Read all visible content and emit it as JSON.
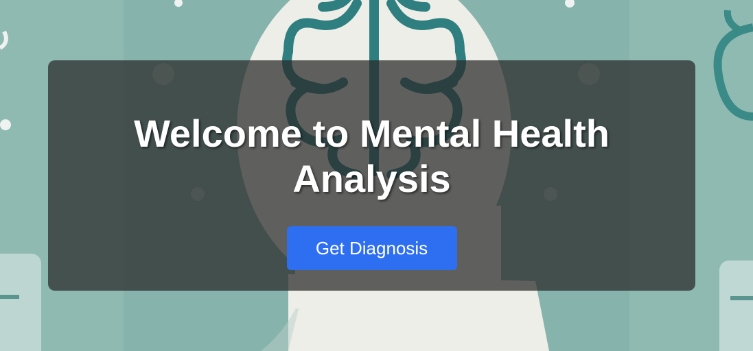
{
  "hero": {
    "title": "Welcome to Mental Health Analysis",
    "cta_label": "Get Diagnosis",
    "background_image": "head-with-brain-illustration"
  },
  "colors": {
    "background_teal": "#86b3ab",
    "head_silhouette": "#eeeee8",
    "brain_outline": "#2f7f80",
    "overlay": "rgba(40,40,40,0.72)",
    "button": "#2e6ff2",
    "text": "#ffffff"
  }
}
